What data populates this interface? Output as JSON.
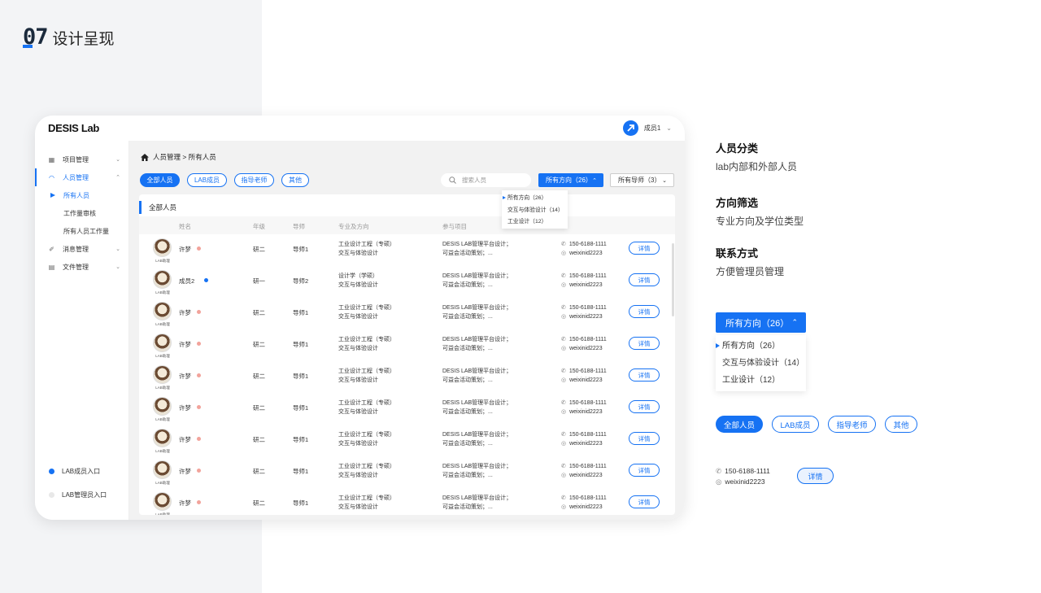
{
  "header": {
    "number": "07",
    "title": "设计呈现"
  },
  "app": {
    "logo": "DESIS Lab",
    "user": "成员1",
    "sidebar": {
      "items": [
        {
          "label": "项目管理"
        },
        {
          "label": "人员管理"
        },
        {
          "label": "所有人员"
        },
        {
          "label": "工作量审核"
        },
        {
          "label": "所有人员工作量"
        },
        {
          "label": "消息管理"
        },
        {
          "label": "文件管理"
        }
      ],
      "entries": [
        {
          "label": "LAB成员入口",
          "color": "#1672f3"
        },
        {
          "label": "LAB管理员入口",
          "color": "#e8e8e8"
        }
      ]
    },
    "breadcrumb": "人员管理 > 所有人员",
    "tabs": [
      "全部人员",
      "LAB成员",
      "指导老师",
      "其他"
    ],
    "search_placeholder": "搜索人员",
    "direction_dropdown": "所有方向（26）",
    "tutor_dropdown": "所有导师（3）",
    "direction_menu": [
      "所有方向（26）",
      "交互与体验设计（14）",
      "工业设计（12）"
    ],
    "card_title": "全部人员",
    "columns": [
      "姓名",
      "年级",
      "导师",
      "专业及方向",
      "参与项目"
    ],
    "avatar_label": "LAB助理",
    "detail_label": "详情",
    "rows": [
      {
        "name": "许梦",
        "status_color": "#f2a39b",
        "year": "研二",
        "tutor": "导师1",
        "major1": "工业设计工程（专硕）",
        "major2": "交互与体验设计",
        "proj1": "DESIS LAB管理平台设计；",
        "proj2": "可益会活动策划；...",
        "phone": "150-6188-1111",
        "wechat": "weixinid2223"
      },
      {
        "name": "成员2",
        "status_color": "#1672f3",
        "year": "研一",
        "tutor": "导师2",
        "major1": "设计学（学硕）",
        "major2": "交互与体验设计",
        "proj1": "DESIS LAB管理平台设计；",
        "proj2": "可益会活动策划；...",
        "phone": "150-6188-1111",
        "wechat": "weixinid2223"
      },
      {
        "name": "许梦",
        "status_color": "#f2a39b",
        "year": "研二",
        "tutor": "导师1",
        "major1": "工业设计工程（专硕）",
        "major2": "交互与体验设计",
        "proj1": "DESIS LAB管理平台设计；",
        "proj2": "可益会活动策划；...",
        "phone": "150-6188-1111",
        "wechat": "weixinid2223"
      },
      {
        "name": "许梦",
        "status_color": "#f2a39b",
        "year": "研二",
        "tutor": "导师1",
        "major1": "工业设计工程（专硕）",
        "major2": "交互与体验设计",
        "proj1": "DESIS LAB管理平台设计；",
        "proj2": "可益会活动策划；...",
        "phone": "150-6188-1111",
        "wechat": "weixinid2223"
      },
      {
        "name": "许梦",
        "status_color": "#f2a39b",
        "year": "研二",
        "tutor": "导师1",
        "major1": "工业设计工程（专硕）",
        "major2": "交互与体验设计",
        "proj1": "DESIS LAB管理平台设计；",
        "proj2": "可益会活动策划；...",
        "phone": "150-6188-1111",
        "wechat": "weixinid2223"
      },
      {
        "name": "许梦",
        "status_color": "#f2a39b",
        "year": "研二",
        "tutor": "导师1",
        "major1": "工业设计工程（专硕）",
        "major2": "交互与体验设计",
        "proj1": "DESIS LAB管理平台设计；",
        "proj2": "可益会活动策划；...",
        "phone": "150-6188-1111",
        "wechat": "weixinid2223"
      },
      {
        "name": "许梦",
        "status_color": "#f2a39b",
        "year": "研二",
        "tutor": "导师1",
        "major1": "工业设计工程（专硕）",
        "major2": "交互与体验设计",
        "proj1": "DESIS LAB管理平台设计；",
        "proj2": "可益会活动策划；...",
        "phone": "150-6188-1111",
        "wechat": "weixinid2223"
      },
      {
        "name": "许梦",
        "status_color": "#f2a39b",
        "year": "研二",
        "tutor": "导师1",
        "major1": "工业设计工程（专硕）",
        "major2": "交互与体验设计",
        "proj1": "DESIS LAB管理平台设计；",
        "proj2": "可益会活动策划；...",
        "phone": "150-6188-1111",
        "wechat": "weixinid2223"
      },
      {
        "name": "许梦",
        "status_color": "#f2a39b",
        "year": "研二",
        "tutor": "导师1",
        "major1": "工业设计工程（专硕）",
        "major2": "交互与体验设计",
        "proj1": "DESIS LAB管理平台设计；",
        "proj2": "可益会活动策划；...",
        "phone": "150-6188-1111",
        "wechat": "weixinid2223"
      }
    ]
  },
  "annotations": [
    {
      "title": "人员分类",
      "subtitle": "lab内部和外部人员"
    },
    {
      "title": "方向筛选",
      "subtitle": "专业方向及学位类型"
    },
    {
      "title": "联系方式",
      "subtitle": "方便管理员管理"
    }
  ],
  "showcase": {
    "dropdown": "所有方向（26）",
    "menu": [
      "所有方向（26）",
      "交互与体验设计（14）",
      "工业设计（12）"
    ],
    "pills": [
      "全部人员",
      "LAB成员",
      "指导老师",
      "其他"
    ],
    "phone": "150-6188-1111",
    "wechat": "weixinid2223",
    "detail": "详情"
  },
  "colors": {
    "accent": "#1672f3"
  }
}
